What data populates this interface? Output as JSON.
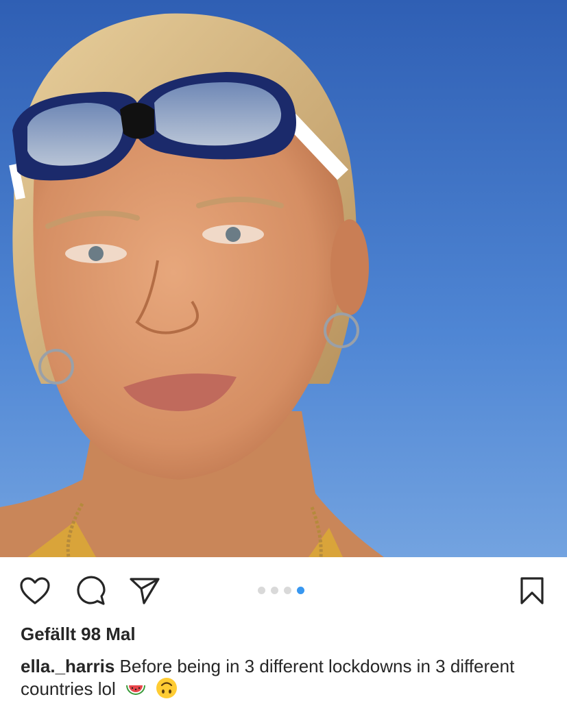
{
  "post": {
    "likes_text": "Gefällt 98 Mal",
    "username": "ella._harris",
    "caption": "Before being in 3 different lockdowns in 3 different countries lol",
    "caption_emojis": [
      "watermelon-emoji",
      "upside-down-face-emoji"
    ]
  },
  "carousel": {
    "total": 4,
    "active_index": 3
  },
  "icons": {
    "like": "heart-icon",
    "comment": "comment-bubble-icon",
    "share": "paper-plane-icon",
    "save": "bookmark-icon"
  },
  "colors": {
    "text": "#262626",
    "dot_active": "#3897f0",
    "dot_inactive": "#d9d9d9",
    "sky": "#4a78c8"
  }
}
